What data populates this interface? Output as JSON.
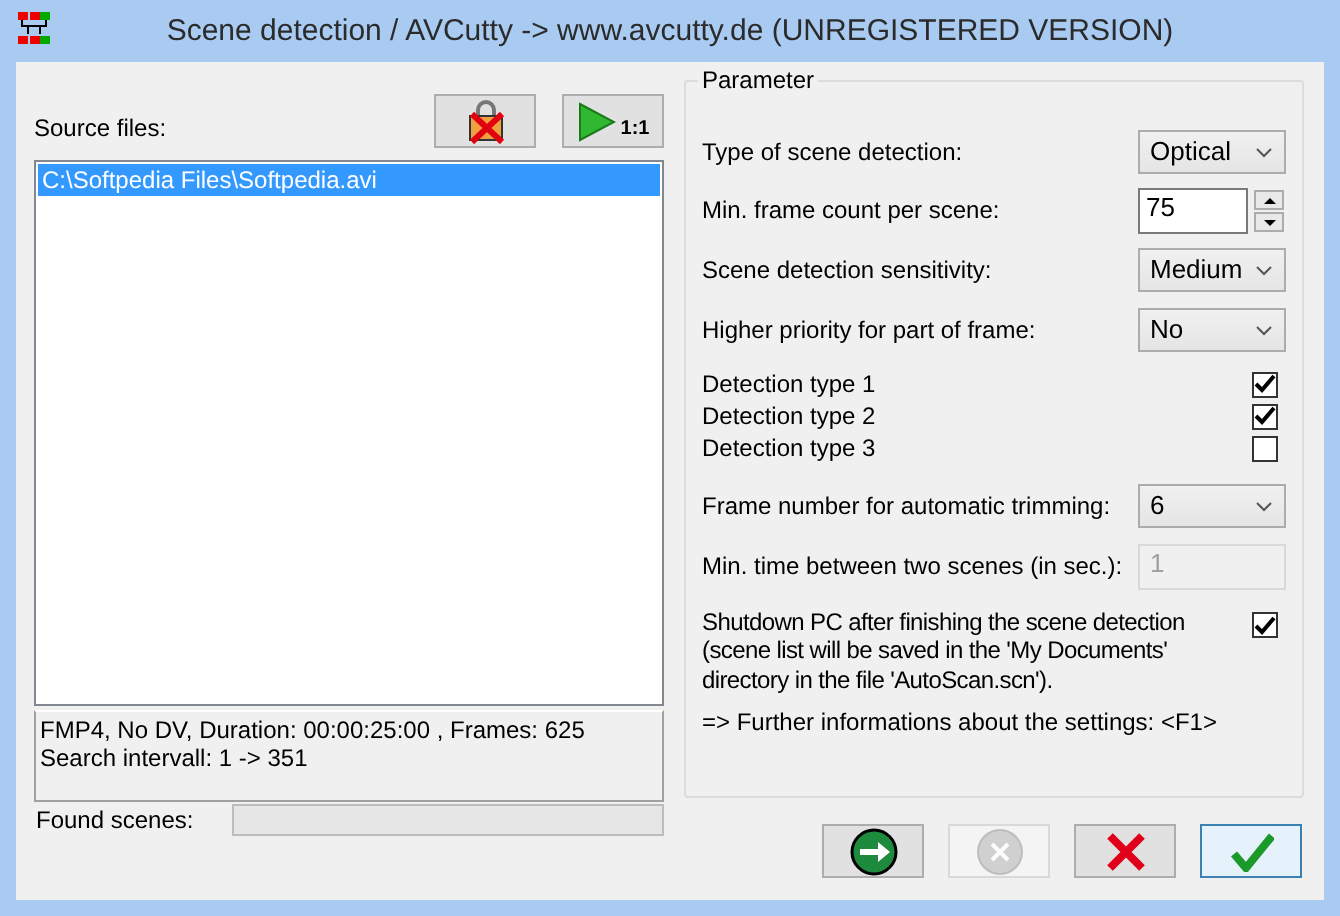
{
  "window": {
    "title": "Scene detection / AVCutty -> www.avcutty.de (UNREGISTERED VERSION)"
  },
  "source_files": {
    "label": "Source files:",
    "toolbar": [
      {
        "kind": "remove"
      },
      {
        "kind": "play",
        "text": "1:1"
      }
    ],
    "files": [
      {
        "path": "C:\\Softpedia Files\\Softpedia.avi",
        "selected": true
      }
    ]
  },
  "info_lines": [
    "FMP4, No DV, Duration: 00:00:25:00 , Frames: 625",
    "Search intervall: 1 -> 351"
  ],
  "found_scenes": {
    "label": "Found scenes:"
  },
  "parameters": {
    "title": "Parameter",
    "rows": [
      {
        "kind": "select",
        "label": "Type of scene detection:",
        "value": "Optical"
      },
      {
        "kind": "spin",
        "label": "Min. frame count per scene:",
        "value": "75"
      },
      {
        "kind": "select",
        "label": "Scene detection sensitivity:",
        "value": "Medium"
      },
      {
        "kind": "select",
        "label": "Higher priority for part of frame:",
        "value": "No"
      },
      {
        "kind": "checkbox",
        "label": "Detection type 1",
        "checked": true
      },
      {
        "kind": "checkbox",
        "label": "Detection type 2",
        "checked": true
      },
      {
        "kind": "checkbox",
        "label": "Detection type 3",
        "checked": false
      },
      {
        "kind": "select",
        "label": "Frame number for automatic trimming:",
        "value": "6"
      },
      {
        "kind": "text",
        "label": "Min. time between two scenes (in sec.):",
        "value": "1",
        "disabled": true
      },
      {
        "kind": "longcheck",
        "label": "Shutdown PC after finishing the scene detection (scene list will be saved in the 'My Documents' directory in the file 'AutoScan.scn').",
        "checked": true
      },
      {
        "kind": "note",
        "label": "=> Further informations about the settings: <F1>"
      }
    ]
  },
  "buttons": [
    {
      "kind": "start",
      "disabled": false,
      "focused": false
    },
    {
      "kind": "cancel",
      "disabled": true,
      "focused": false
    },
    {
      "kind": "close",
      "disabled": false,
      "focused": false
    },
    {
      "kind": "ok",
      "disabled": false,
      "focused": true
    }
  ]
}
